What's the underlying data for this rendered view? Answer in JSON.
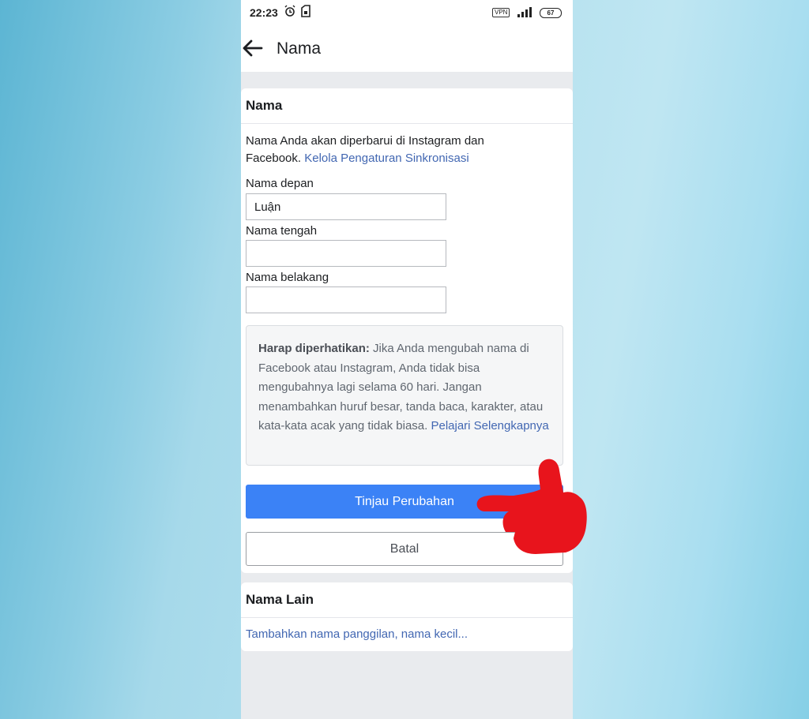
{
  "status_bar": {
    "time": "22:23",
    "vpn_label": "VPN",
    "battery_level": "67",
    "icons": [
      "alarm-icon",
      "sim-icon",
      "signal-icon",
      "battery-icon"
    ]
  },
  "header": {
    "back_icon": "arrow-left-icon",
    "title": "Nama"
  },
  "name_section": {
    "title": "Nama",
    "intro_text": "Nama Anda akan diperbarui di Instagram dan Facebook. ",
    "sync_link": "Kelola Pengaturan Sinkronisasi",
    "fields": [
      {
        "label": "Nama depan",
        "value": "Luận",
        "placeholder": ""
      },
      {
        "label": "Nama tengah",
        "value": "",
        "placeholder": ""
      },
      {
        "label": "Nama belakang",
        "value": "",
        "placeholder": ""
      }
    ],
    "notice": {
      "bold": "Harap diperhatikan:",
      "text": " Jika Anda mengubah nama di Facebook atau Instagram, Anda tidak bisa mengubahnya lagi selama 60 hari. Jangan menambahkan huruf besar, tanda baca, karakter, atau kata-kata acak yang tidak biasa. ",
      "link": "Pelajari Selengkapnya"
    },
    "review_button": "Tinjau Perubahan",
    "cancel_button": "Batal"
  },
  "other_names": {
    "title": "Nama Lain",
    "add_link": "Tambahkan nama panggilan, nama kecil..."
  },
  "colors": {
    "primary_button": "#3b82f6",
    "link": "#4267b2",
    "pointer_hand": "#e8141c"
  }
}
